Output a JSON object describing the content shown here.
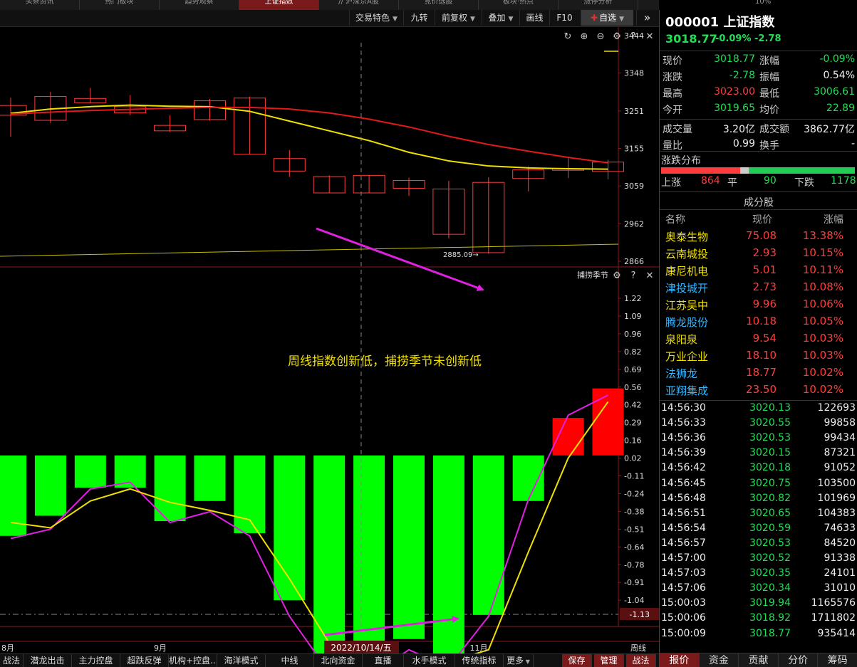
{
  "top_tabs": [
    {
      "label": "头条资讯",
      "active": false
    },
    {
      "label": "热门板块",
      "active": false
    },
    {
      "label": "趋势观察",
      "active": false
    },
    {
      "label": "上证指数",
      "active": true
    },
    {
      "label": "// 沪深京A股",
      "active": false
    },
    {
      "label": "竞价选股",
      "active": false
    },
    {
      "label": "板块·热点",
      "active": false
    },
    {
      "label": "涨停分析",
      "active": false
    }
  ],
  "top_right_text": "10%",
  "toolbar": {
    "jiaoyi": "交易特色",
    "jiuzhuan": "九转",
    "fuquan": "前复权",
    "diejia": "叠加",
    "huaxian": "画线",
    "f10": "F10",
    "zixuan": "自选",
    "more": "»"
  },
  "price_axis": [
    "3444",
    "3348",
    "3251",
    "3155",
    "3059",
    "2962",
    "2866"
  ],
  "low_marker": "2885.09",
  "indicator_name": "捕捞季节",
  "indicator_axis": [
    "1.22",
    "1.09",
    "0.96",
    "0.82",
    "0.69",
    "0.56",
    "0.42",
    "0.29",
    "0.16",
    "0.02",
    "-0.11",
    "-0.24",
    "-0.38",
    "-0.51",
    "-0.64",
    "-0.78",
    "-0.91",
    "-1.04"
  ],
  "indicator_marker": "-1.13",
  "annotation": "周线指数创新低，捕捞季节未创新低",
  "x_labels": {
    "left": "8月",
    "sep": "9月",
    "crosshair": "2022/10/14/五",
    "nov": "11月",
    "period": "周线"
  },
  "chart_data": [
    {
      "type": "candlestick",
      "title": "上证指数",
      "period": "周线",
      "ylim": [
        2866,
        3444
      ],
      "candles": [
        {
          "open": 3240,
          "close": 3265,
          "high": 3285,
          "low": 3185
        },
        {
          "open": 3227,
          "close": 3288,
          "high": 3300,
          "low": 3220
        },
        {
          "open": 3272,
          "close": 3283,
          "high": 3310,
          "low": 3270
        },
        {
          "open": 3246,
          "close": 3262,
          "high": 3292,
          "low": 3240
        },
        {
          "open": 3200,
          "close": 3214,
          "high": 3240,
          "low": 3197
        },
        {
          "open": 3229,
          "close": 3277,
          "high": 3282,
          "low": 3226
        },
        {
          "open": 3140,
          "close": 3284,
          "high": 3288,
          "low": 3140
        },
        {
          "open": 3097,
          "close": 3129,
          "high": 3151,
          "low": 3082
        },
        {
          "open": 3041,
          "close": 3083,
          "high": 3086,
          "low": 3041
        },
        {
          "open": 3041,
          "close": 3086,
          "high": 3086,
          "low": 3041
        },
        {
          "open": 3053,
          "close": 3073,
          "high": 3080,
          "low": 3033
        },
        {
          "open": 2935,
          "close": 3051,
          "high": 3072,
          "low": 2925
        },
        {
          "open": 2888,
          "close": 3068,
          "high": 3081,
          "low": 2885
        },
        {
          "open": 3078,
          "close": 3100,
          "high": 3109,
          "low": 3045
        },
        {
          "open": 3099,
          "close": 3103,
          "high": 3130,
          "low": 3079
        },
        {
          "open": 3096,
          "close": 3120,
          "high": 3126,
          "low": 3076
        }
      ],
      "ma_series": [
        {
          "color": "#f0e000",
          "values": [
            3245,
            3256,
            3262,
            3266,
            3263,
            3262,
            3250,
            3225,
            3200,
            3175,
            3145,
            3123,
            3110,
            3105,
            3103,
            3102
          ]
        },
        {
          "color": "#e01a1a",
          "values": [
            3243,
            3248,
            3252,
            3255,
            3258,
            3260,
            3260,
            3256,
            3246,
            3230,
            3210,
            3186,
            3165,
            3148,
            3132,
            3118
          ]
        }
      ]
    },
    {
      "type": "bar",
      "title": "捕捞季节",
      "ylim": [
        -1.13,
        1.22
      ],
      "values": [
        -0.6,
        -0.45,
        -0.24,
        -0.24,
        -0.49,
        -0.34,
        -0.58,
        -1.08,
        -1.55,
        -1.62,
        -1.37,
        -1.61,
        -1.19,
        -0.34,
        0.28,
        0.5
      ],
      "line_series": [
        {
          "color": "#e020e0",
          "values": [
            -0.62,
            -0.55,
            -0.25,
            -0.2,
            -0.5,
            -0.42,
            -0.6,
            -1.2,
            -1.62,
            -1.65,
            -1.45,
            -1.58,
            -1.2,
            -0.33,
            0.3,
            0.45
          ]
        },
        {
          "color": "#f0e000",
          "values": [
            -0.5,
            -0.54,
            -0.34,
            -0.25,
            -0.35,
            -0.41,
            -0.48,
            -0.92,
            -1.4,
            -1.64,
            -1.54,
            -1.54,
            -1.45,
            -0.72,
            -0.02,
            0.4
          ]
        }
      ]
    }
  ],
  "quote": {
    "code_name": "000001 上证指数",
    "price": "3018.77",
    "change": "-0.09% -2.78",
    "rows": [
      {
        "l1": "现价",
        "v1": "3018.77",
        "c1": "green",
        "l2": "涨幅",
        "v2": "-0.09%",
        "c2": "green"
      },
      {
        "l1": "涨跌",
        "v1": "-2.78",
        "c1": "green",
        "l2": "振幅",
        "v2": "0.54%",
        "c2": "white"
      },
      {
        "l1": "最高",
        "v1": "3023.00",
        "c1": "red",
        "l2": "最低",
        "v2": "3006.61",
        "c2": "green"
      },
      {
        "l1": "今开",
        "v1": "3019.65",
        "c1": "green",
        "l2": "均价",
        "v2": "22.89",
        "c2": "green"
      },
      {
        "l1": "成交量",
        "v1": "3.20亿",
        "c1": "white",
        "l2": "成交额",
        "v2": "3862.77亿",
        "c2": "white"
      },
      {
        "l1": "量比",
        "v1": "0.99",
        "c1": "white",
        "l2": "换手",
        "v2": "-",
        "c2": "white"
      }
    ],
    "distribution_label": "涨跌分布",
    "up_label": "上涨",
    "up": "864",
    "flat_label": "平",
    "flat": "90",
    "down_label": "下跌",
    "down": "1178",
    "constituents_title": "成分股",
    "constituents_headers": [
      "名称",
      "现价",
      "涨幅"
    ],
    "constituents": [
      {
        "name": "奥泰生物",
        "price": "75.08",
        "pct": "13.38%",
        "color": "yellow"
      },
      {
        "name": "云南城投",
        "price": "2.93",
        "pct": "10.15%",
        "color": "yellow"
      },
      {
        "name": "康尼机电",
        "price": "5.01",
        "pct": "10.11%",
        "color": "yellow"
      },
      {
        "name": "津投城开",
        "price": "2.73",
        "pct": "10.08%",
        "color": "cyan"
      },
      {
        "name": "江苏吴中",
        "price": "9.96",
        "pct": "10.06%",
        "color": "yellow"
      },
      {
        "name": "腾龙股份",
        "price": "10.18",
        "pct": "10.05%",
        "color": "cyan"
      },
      {
        "name": "泉阳泉",
        "price": "9.54",
        "pct": "10.03%",
        "color": "yellow"
      },
      {
        "name": "万业企业",
        "price": "18.10",
        "pct": "10.03%",
        "color": "yellow"
      },
      {
        "name": "法狮龙",
        "price": "18.77",
        "pct": "10.02%",
        "color": "cyan"
      },
      {
        "name": "亚翔集成",
        "price": "23.50",
        "pct": "10.02%",
        "color": "cyan"
      }
    ],
    "ticks": [
      {
        "time": "14:56:30",
        "price": "3020.13",
        "vol": "122693"
      },
      {
        "time": "14:56:33",
        "price": "3020.55",
        "vol": "99858"
      },
      {
        "time": "14:56:36",
        "price": "3020.53",
        "vol": "99434"
      },
      {
        "time": "14:56:39",
        "price": "3020.15",
        "vol": "87321"
      },
      {
        "time": "14:56:42",
        "price": "3020.18",
        "vol": "91052"
      },
      {
        "time": "14:56:45",
        "price": "3020.75",
        "vol": "103500"
      },
      {
        "time": "14:56:48",
        "price": "3020.82",
        "vol": "101969"
      },
      {
        "time": "14:56:51",
        "price": "3020.65",
        "vol": "104383"
      },
      {
        "time": "14:56:54",
        "price": "3020.59",
        "vol": "74633"
      },
      {
        "time": "14:56:57",
        "price": "3020.53",
        "vol": "84520"
      },
      {
        "time": "14:57:00",
        "price": "3020.52",
        "vol": "91338"
      },
      {
        "time": "14:57:03",
        "price": "3020.35",
        "vol": "24101"
      },
      {
        "time": "14:57:06",
        "price": "3020.34",
        "vol": "31010"
      },
      {
        "time": "15:00:03",
        "price": "3019.94",
        "vol": "1165576"
      },
      {
        "time": "15:00:06",
        "price": "3018.92",
        "vol": "1711802"
      },
      {
        "time": "15:00:09",
        "price": "3018.77",
        "vol": "935414"
      }
    ],
    "tabs": [
      "报价",
      "资金",
      "贡献",
      "分价",
      "筹码"
    ]
  },
  "bottom_bar": [
    "战法",
    "潜龙出击",
    "主力控盘",
    "超跌反弹",
    "机构+控盘...",
    "海洋模式",
    "中线",
    "北向资金",
    "直播",
    "水手模式",
    "传统指标",
    "更多"
  ],
  "bottom_right": [
    "保存",
    "管理",
    "战法"
  ],
  "colors": {
    "up": "#ff3c3c",
    "down": "#00ffff",
    "vol_down": "#00ff00",
    "vol_up": "#ff0000",
    "arrow": "#e020e0"
  }
}
